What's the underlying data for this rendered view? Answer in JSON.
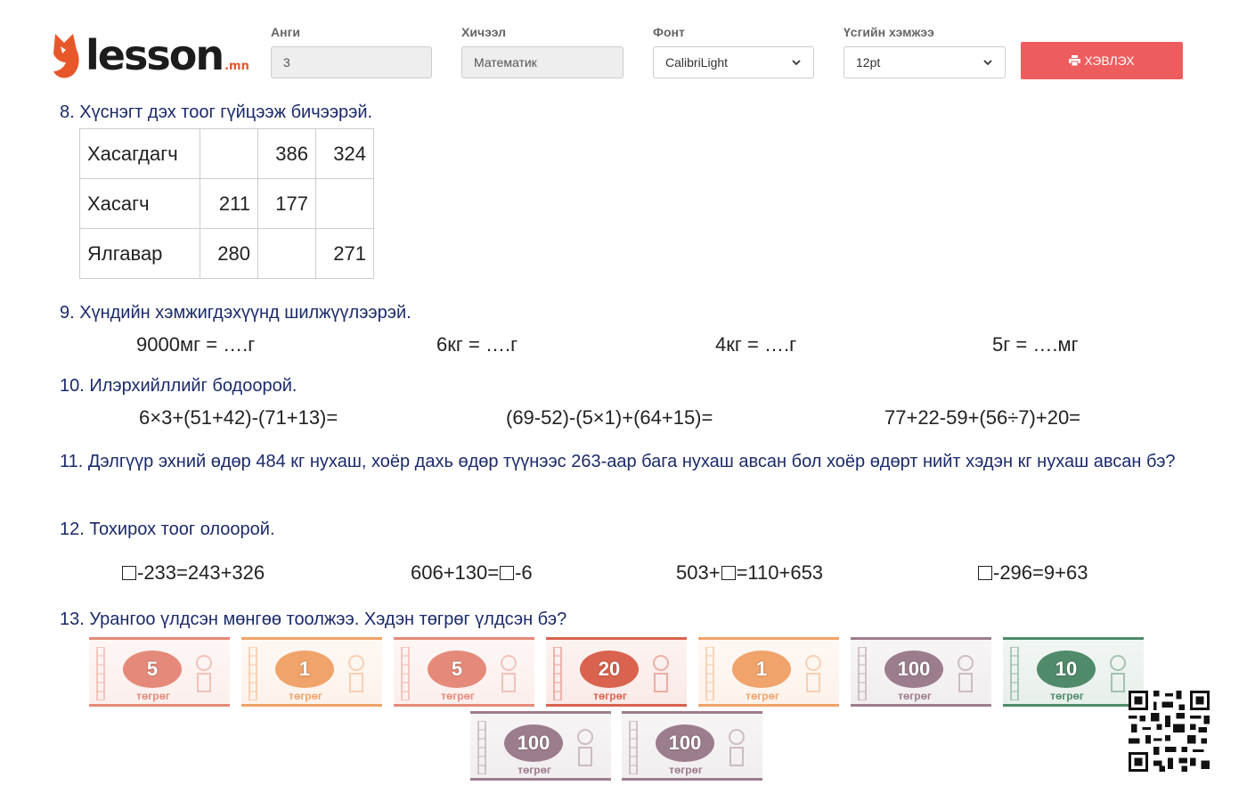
{
  "header": {
    "logo_word": "lesson",
    "logo_tld": ".mn",
    "grade_label": "Анги",
    "grade_value": "3",
    "subject_label": "Хичээл",
    "subject_value": "Математик",
    "font_label": "Фонт",
    "font_value": "CalibriLight",
    "size_label": "Үсгийн хэмжээ",
    "size_value": "12pt",
    "print_label": "ХЭВЛЭХ"
  },
  "q8": {
    "title": "8. Хүснэгт дэх тоог гүйцээж бичээрэй.",
    "rows": [
      {
        "head": "Хасагдагч",
        "cells": [
          "",
          "386",
          "324"
        ]
      },
      {
        "head": "Хасагч",
        "cells": [
          "211",
          "177",
          ""
        ]
      },
      {
        "head": "Ялгавар",
        "cells": [
          "280",
          "",
          "271"
        ]
      }
    ]
  },
  "q9": {
    "title": "9. Хүндийн хэмжигдэхүүнд шилжүүлээрэй.",
    "items": [
      "9000мг = ….г",
      "6кг = ….г",
      "4кг = ….г",
      "5г = ….мг"
    ]
  },
  "q10": {
    "title": "10. Илэрхийллийг бодоорой.",
    "items": [
      "6×3+(51+42)-(71+13)=",
      "(69-52)-(5×1)+(64+15)=",
      "77+22-59+(56÷7)+20="
    ]
  },
  "q11": {
    "title": "11. Дэлгүүр эхний өдөр 484 кг нухаш, хоёр дахь өдөр түүнээс 263-аар бага нухаш авсан бол хоёр өдөрт нийт хэдэн кг нухаш авсан бэ?"
  },
  "q12": {
    "title": "12. Тохирох тоог олоорой.",
    "items": [
      {
        "pre": "",
        "post": "-233=243+326"
      },
      {
        "pre": "606+130=",
        "post": "-6"
      },
      {
        "pre": "503+",
        "post": "=110+653"
      },
      {
        "pre": "",
        "post": "-296=9+63"
      }
    ]
  },
  "q13": {
    "title": "13. Урангоо үлдсэн мөнгөө тоолжээ. Хэдэн төгрөг үлдсэн бэ?",
    "currency": "төгрөг",
    "notes": [
      {
        "value": "5",
        "color": "#e58a7a"
      },
      {
        "value": "1",
        "color": "#f0a36a"
      },
      {
        "value": "5",
        "color": "#e58a7a"
      },
      {
        "value": "20",
        "color": "#d9634f"
      },
      {
        "value": "1",
        "color": "#f0a36a"
      },
      {
        "value": "100",
        "color": "#9c7d8d"
      },
      {
        "value": "10",
        "color": "#4f8a6a"
      },
      {
        "value": "100",
        "color": "#9c7d8d"
      },
      {
        "value": "100",
        "color": "#9c7d8d"
      }
    ]
  }
}
